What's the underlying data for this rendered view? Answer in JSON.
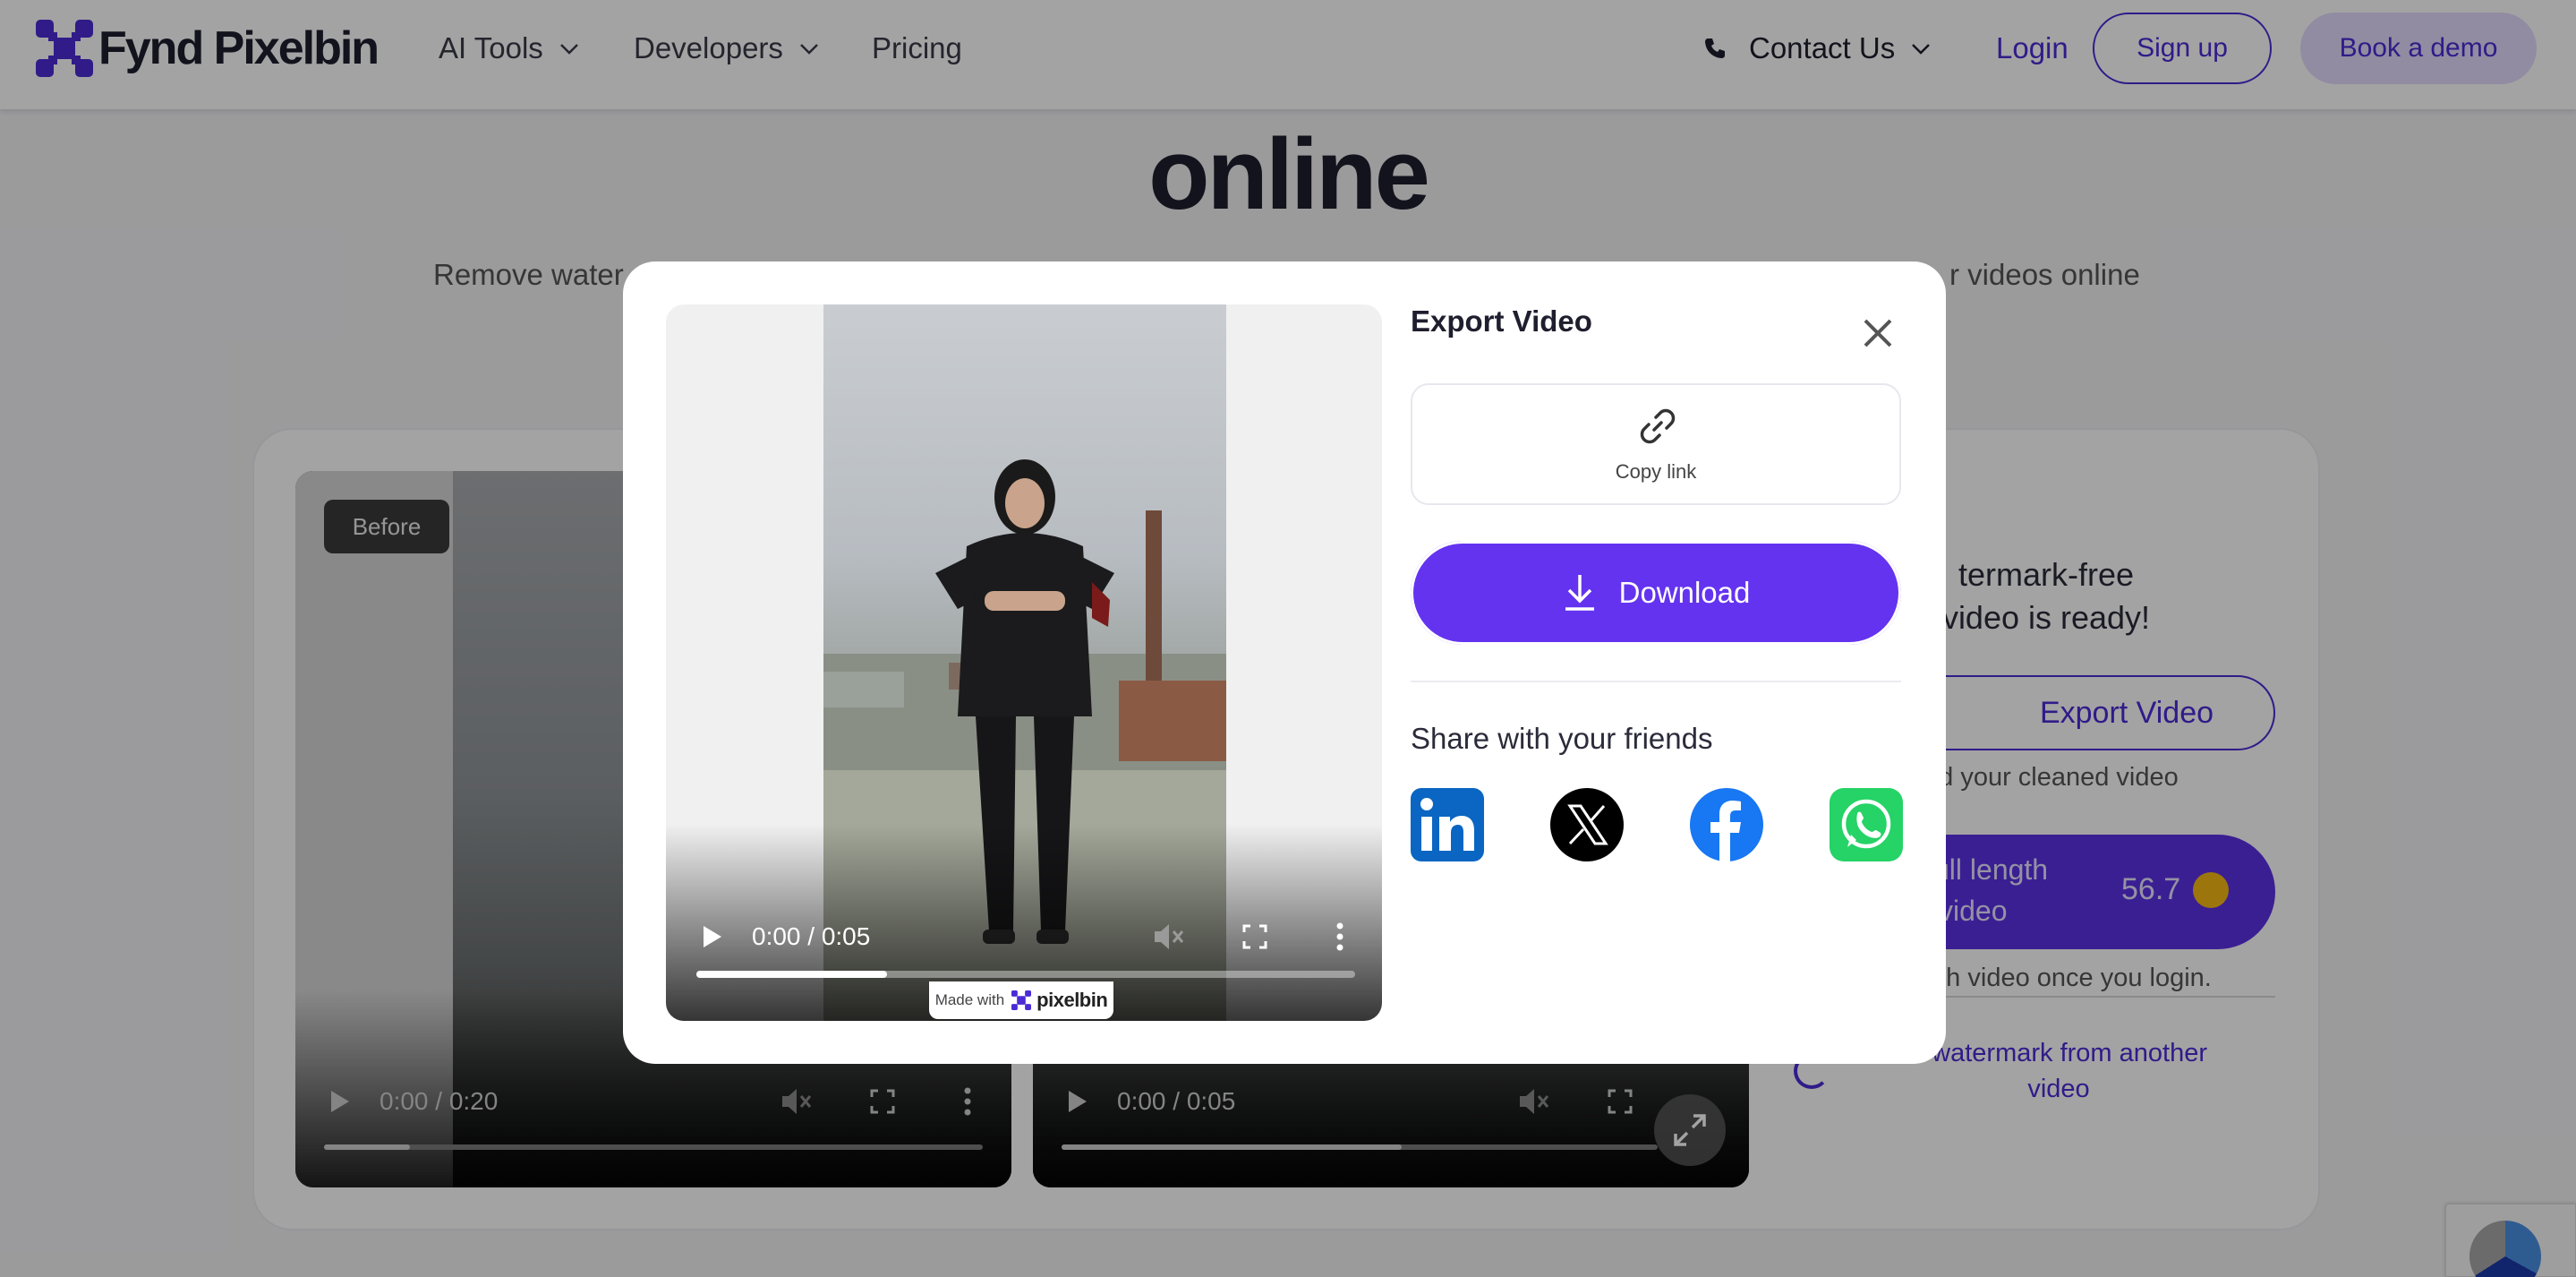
{
  "nav": {
    "brand": "Fynd Pixelbin",
    "items": [
      {
        "label": "AI Tools"
      },
      {
        "label": "Developers"
      },
      {
        "label": "Pricing"
      }
    ],
    "contact": "Contact Us",
    "login": "Login",
    "signup": "Sign up",
    "demo": "Book a demo"
  },
  "hero": {
    "title": "online",
    "sub_left": "Remove water",
    "sub_right": "r videos online"
  },
  "tool": {
    "before_badge": "Before",
    "before_time": "0:00 / 0:20",
    "before_progress": 0.13,
    "after_time": "0:00 / 0:05",
    "after_progress": 0.57,
    "ready_text": "termark-free video is ready!",
    "export_label": "Export Video",
    "download_note": "ad your cleaned video",
    "full_label_1": "ull length",
    "full_label_2": "video",
    "credits": "56.7",
    "login_note": "gth video once you login.",
    "another": "e watermark from another video"
  },
  "modal": {
    "title": "Export Video",
    "copy_link": "Copy link",
    "download": "Download",
    "share_title": "Share with your friends",
    "video_time": "0:00 / 0:05",
    "video_progress": 0.29,
    "made_with": "Made with",
    "made_with_brand": "pixelbin",
    "social": [
      "linkedin-icon",
      "x-icon",
      "facebook-icon",
      "whatsapp-icon"
    ]
  },
  "colors": {
    "primary": "#5b31e6",
    "download_btn": "#6433f0",
    "linkedin": "#0a66c2",
    "facebook": "#1877f2",
    "whatsapp": "#25d366"
  }
}
